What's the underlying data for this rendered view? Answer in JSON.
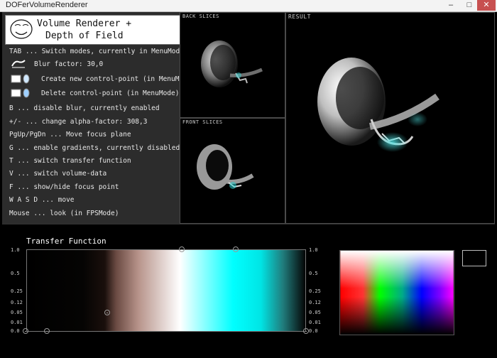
{
  "window": {
    "title": "DOFerVolumeRenderer",
    "min_symbol": "–",
    "max_symbol": "□",
    "close_symbol": "✕"
  },
  "logo": {
    "line1": "Volume Renderer +",
    "line2": "Depth of Field"
  },
  "menu": {
    "tab": "TAB ... Switch modes, currently in MenuMode",
    "blur": "Blur factor: 30,0",
    "create": "Create new control-point (in MenuMode)",
    "delete": "Delete control-point (in MenuMode)",
    "b": "B ... disable blur, currently enabled",
    "alpha": "+/- ... change alpha-factor: 308,3",
    "pg": "PgUp/PgDn ... Move focus plane",
    "g": "G ... enable gradients, currently disabled",
    "t": "T ... switch transfer function",
    "v": "V ... switch volume-data",
    "f": "F ... show/hide focus point",
    "wasd": "W A S D ... move",
    "mouse": "Mouse ... look (in FPSMode)"
  },
  "panels": {
    "back": "BACK SLICES",
    "front": "FRONT SLICES",
    "result": "RESULT"
  },
  "transfer_function": {
    "title": "Transfer Function",
    "ticks": [
      "1.0",
      "0.5",
      "0.25",
      "0.12",
      "0.05",
      "0.01",
      "0.0"
    ]
  },
  "icons": {
    "face": "rage-face-icon",
    "blur": "blur-mouse-icon",
    "create": "ctrl-click-icon",
    "delete": "delete-click-icon"
  }
}
